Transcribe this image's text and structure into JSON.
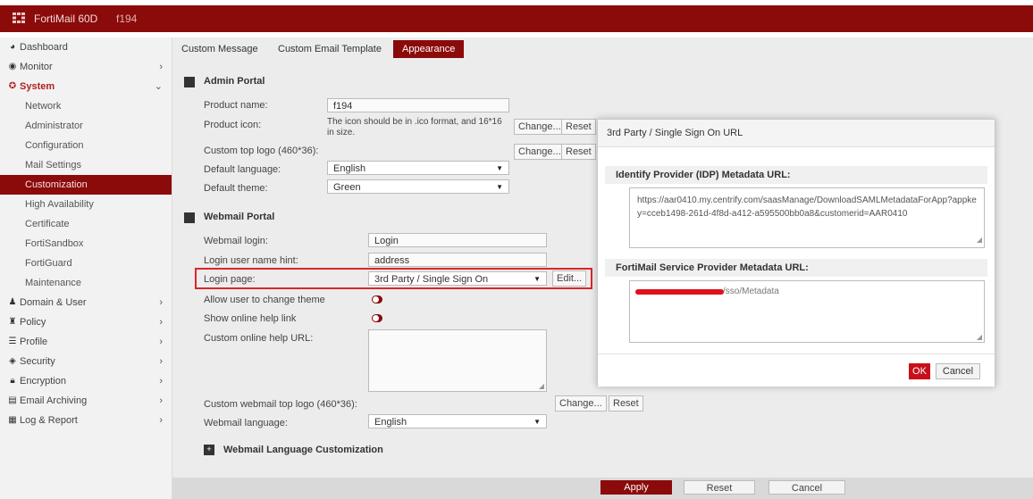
{
  "app": {
    "title": "FortiMail 60D",
    "hostname": "f194"
  },
  "sidebar": {
    "items": [
      {
        "icon": "dashboard-icon",
        "label": "Dashboard",
        "chevron": ""
      },
      {
        "icon": "monitor-icon",
        "label": "Monitor",
        "chevron": "›"
      },
      {
        "icon": "system-icon",
        "label": "System",
        "chevron": "⌄"
      },
      {
        "label": "Network"
      },
      {
        "label": "Administrator"
      },
      {
        "label": "Configuration"
      },
      {
        "label": "Mail Settings"
      },
      {
        "label": "Customization"
      },
      {
        "label": "High Availability"
      },
      {
        "label": "Certificate"
      },
      {
        "label": "FortiSandbox"
      },
      {
        "label": "FortiGuard"
      },
      {
        "label": "Maintenance"
      },
      {
        "icon": "domain-user-icon",
        "label": "Domain & User",
        "chevron": "›"
      },
      {
        "icon": "policy-icon",
        "label": "Policy",
        "chevron": "›"
      },
      {
        "icon": "profile-icon",
        "label": "Profile",
        "chevron": "›"
      },
      {
        "icon": "security-icon",
        "label": "Security",
        "chevron": "›"
      },
      {
        "icon": "encryption-icon",
        "label": "Encryption",
        "chevron": "›"
      },
      {
        "icon": "email-archiving-icon",
        "label": "Email Archiving",
        "chevron": "›"
      },
      {
        "icon": "log-report-icon",
        "label": "Log & Report",
        "chevron": "›"
      }
    ]
  },
  "tabs": [
    {
      "label": "Custom Message"
    },
    {
      "label": "Custom Email Template"
    },
    {
      "label": "Appearance"
    }
  ],
  "admin_portal": {
    "header": "Admin Portal",
    "product_name_label": "Product name:",
    "product_name_value": "f194",
    "product_icon_label": "Product icon:",
    "product_icon_note": "The icon should be in .ico format, and 16*16 in size.",
    "custom_top_logo_label": "Custom top logo (460*36):",
    "default_language_label": "Default language:",
    "default_language_value": "English",
    "default_theme_label": "Default theme:",
    "default_theme_value": "Green",
    "change_label": "Change...",
    "reset_label": "Reset"
  },
  "webmail_portal": {
    "header": "Webmail Portal",
    "webmail_login_label": "Webmail login:",
    "webmail_login_value": "Login",
    "login_hint_label": "Login user name hint:",
    "login_hint_value": "address",
    "login_page_label": "Login page:",
    "login_page_value": "3rd Party / Single Sign On",
    "edit_label": "Edit...",
    "allow_theme_label": "Allow user to change theme",
    "show_help_label": "Show online help link",
    "custom_help_label": "Custom online help URL:",
    "custom_logo_label": "Custom webmail top logo (460*36):",
    "change_label": "Change...",
    "reset_label": "Reset",
    "language_label": "Webmail language:",
    "language_value": "English",
    "lang_custom_header": "Webmail Language Customization"
  },
  "footer": {
    "apply": "Apply",
    "reset": "Reset",
    "cancel": "Cancel"
  },
  "dialog": {
    "title": "3rd Party / Single Sign On URL",
    "idp_header": "Identify Provider (IDP) Metadata URL:",
    "idp_value": "https://aar0410.my.centrify.com/saasManage/DownloadSAMLMetadataForApp?appkey=cceb1498-261d-4f8d-a412-a595500bb0a8&customerid=AAR0410",
    "sp_header": "FortiMail Service Provider Metadata URL:",
    "sp_value": "/sso/Metadata",
    "ok": "OK",
    "cancel": "Cancel"
  },
  "colors": {
    "brand": "#8b0a0a",
    "highlight": "#d9262b",
    "redaction": "#e0101a"
  }
}
